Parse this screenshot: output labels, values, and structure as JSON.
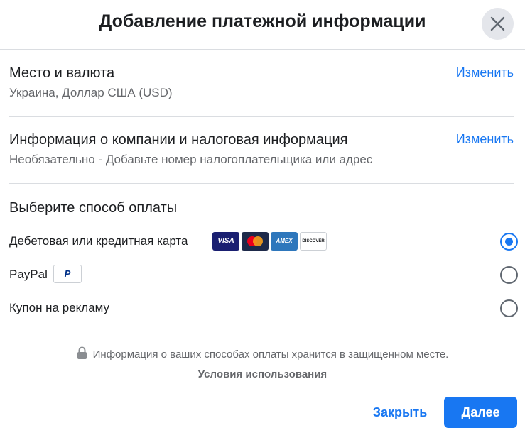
{
  "dialog": {
    "title": "Добавление платежной информации"
  },
  "location": {
    "title": "Место и валюта",
    "value": "Украина, Доллар США (USD)",
    "change_label": "Изменить"
  },
  "business": {
    "title": "Информация о компании и налоговая информация",
    "value": "Необязательно - Добавьте номер налогоплательщика или адрес",
    "change_label": "Изменить"
  },
  "payment": {
    "title": "Выберите способ оплаты",
    "options": [
      {
        "label": "Дебетовая или кредитная карта",
        "selected": true,
        "icons": [
          "visa-icon",
          "mastercard-icon",
          "amex-icon",
          "discover-icon"
        ]
      },
      {
        "label": "PayPal",
        "selected": false,
        "icons": [
          "paypal-icon"
        ]
      },
      {
        "label": "Купон на рекламу",
        "selected": false,
        "icons": []
      }
    ],
    "card_texts": {
      "visa": "VISA",
      "amex": "AMEX",
      "discover": "DISCOVER",
      "paypal": "P"
    }
  },
  "footer": {
    "secure_text": "Информация о ваших способах оплаты хранится в защищенном месте.",
    "terms_label": "Условия использования",
    "close_label": "Закрыть",
    "next_label": "Далее"
  },
  "colors": {
    "accent": "#1877f2",
    "text": "#1c1e21",
    "secondary_text": "#65676b",
    "divider": "#dadde1"
  }
}
